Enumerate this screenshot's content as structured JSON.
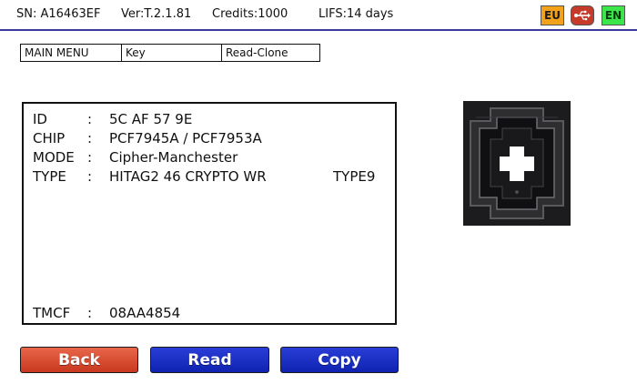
{
  "status": {
    "sn": "SN: A16463EF",
    "version": "Ver:T.2.1.81",
    "credits": "Credits:1000",
    "lifs": "LIFS:14 days",
    "badges": {
      "region": "EU",
      "language": "EN"
    }
  },
  "breadcrumb": [
    "MAIN MENU",
    "Key",
    "Read-Clone"
  ],
  "info": {
    "separator": ":",
    "id": {
      "label": "ID",
      "value": "5C  AF  57  9E"
    },
    "chip": {
      "label": "CHIP",
      "value": "PCF7945A  /  PCF7953A"
    },
    "mode": {
      "label": "MODE",
      "value": "Cipher-Manchester"
    },
    "type": {
      "label": "TYPE",
      "value": "HITAG2  46  CRYPTO  WR",
      "extra": "TYPE9"
    },
    "tmcf": {
      "label": "TMCF",
      "value": "08AA4854"
    }
  },
  "buttons": {
    "back": "Back",
    "read": "Read",
    "copy": "Copy"
  },
  "colors": {
    "back_button": "#d84a2e",
    "action_button": "#1a2fc6",
    "status_underline": "#3a3a9a"
  },
  "icons": {
    "usb": "usb-icon",
    "key_slot": "transponder-slot-icon"
  }
}
